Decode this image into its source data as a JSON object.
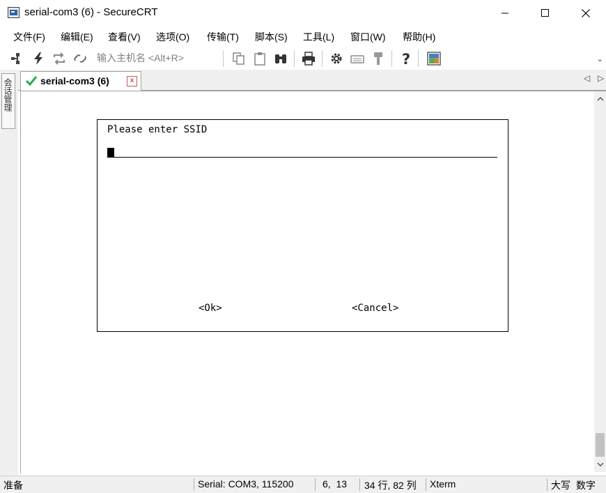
{
  "window": {
    "title": "serial-com3 (6) - SecureCRT",
    "icon": "securecrt-app-icon",
    "controls": [
      "minimize-icon",
      "maximize-icon",
      "close-icon"
    ]
  },
  "menu": {
    "items": [
      {
        "label": "文件(F)"
      },
      {
        "label": "编辑(E)"
      },
      {
        "label": "查看(V)"
      },
      {
        "label": "选项(O)"
      },
      {
        "label": "传输(T)"
      },
      {
        "label": "脚本(S)"
      },
      {
        "label": "工具(L)"
      },
      {
        "label": "窗口(W)"
      },
      {
        "label": "帮助(H)"
      }
    ]
  },
  "toolbar": {
    "host_placeholder": "输入主机名 <Alt+R>",
    "icons": [
      "connect-icon",
      "quick-connect-icon",
      "reconnect-icon",
      "disconnect-icon",
      "copy-icon",
      "paste-icon",
      "find-icon",
      "print-icon",
      "settings-icon",
      "keymap-icon",
      "key-icon",
      "help-icon",
      "sftp-icon"
    ]
  },
  "side_panel": {
    "tab_label": "会话管理"
  },
  "tabs": [
    {
      "label": "serial-com3 (6)",
      "status": "connected",
      "close": "x"
    }
  ],
  "tab_nav": {
    "prev": "◁",
    "next": "▷"
  },
  "dialog": {
    "prompt": "Please enter SSID",
    "input_value": "",
    "ok_label": "<Ok>",
    "cancel_label": "<Cancel>"
  },
  "statusbar": {
    "ready": "准备",
    "connection": "Serial: COM3, 115200",
    "cursor_pos": "6,  13",
    "size": "34 行, 82 列",
    "terminal_type": "Xterm",
    "caps": "大写",
    "num": "数字"
  },
  "colors": {
    "check": "#22b14c",
    "close_x": "#c02020",
    "chrome": "#f0f0f0"
  }
}
